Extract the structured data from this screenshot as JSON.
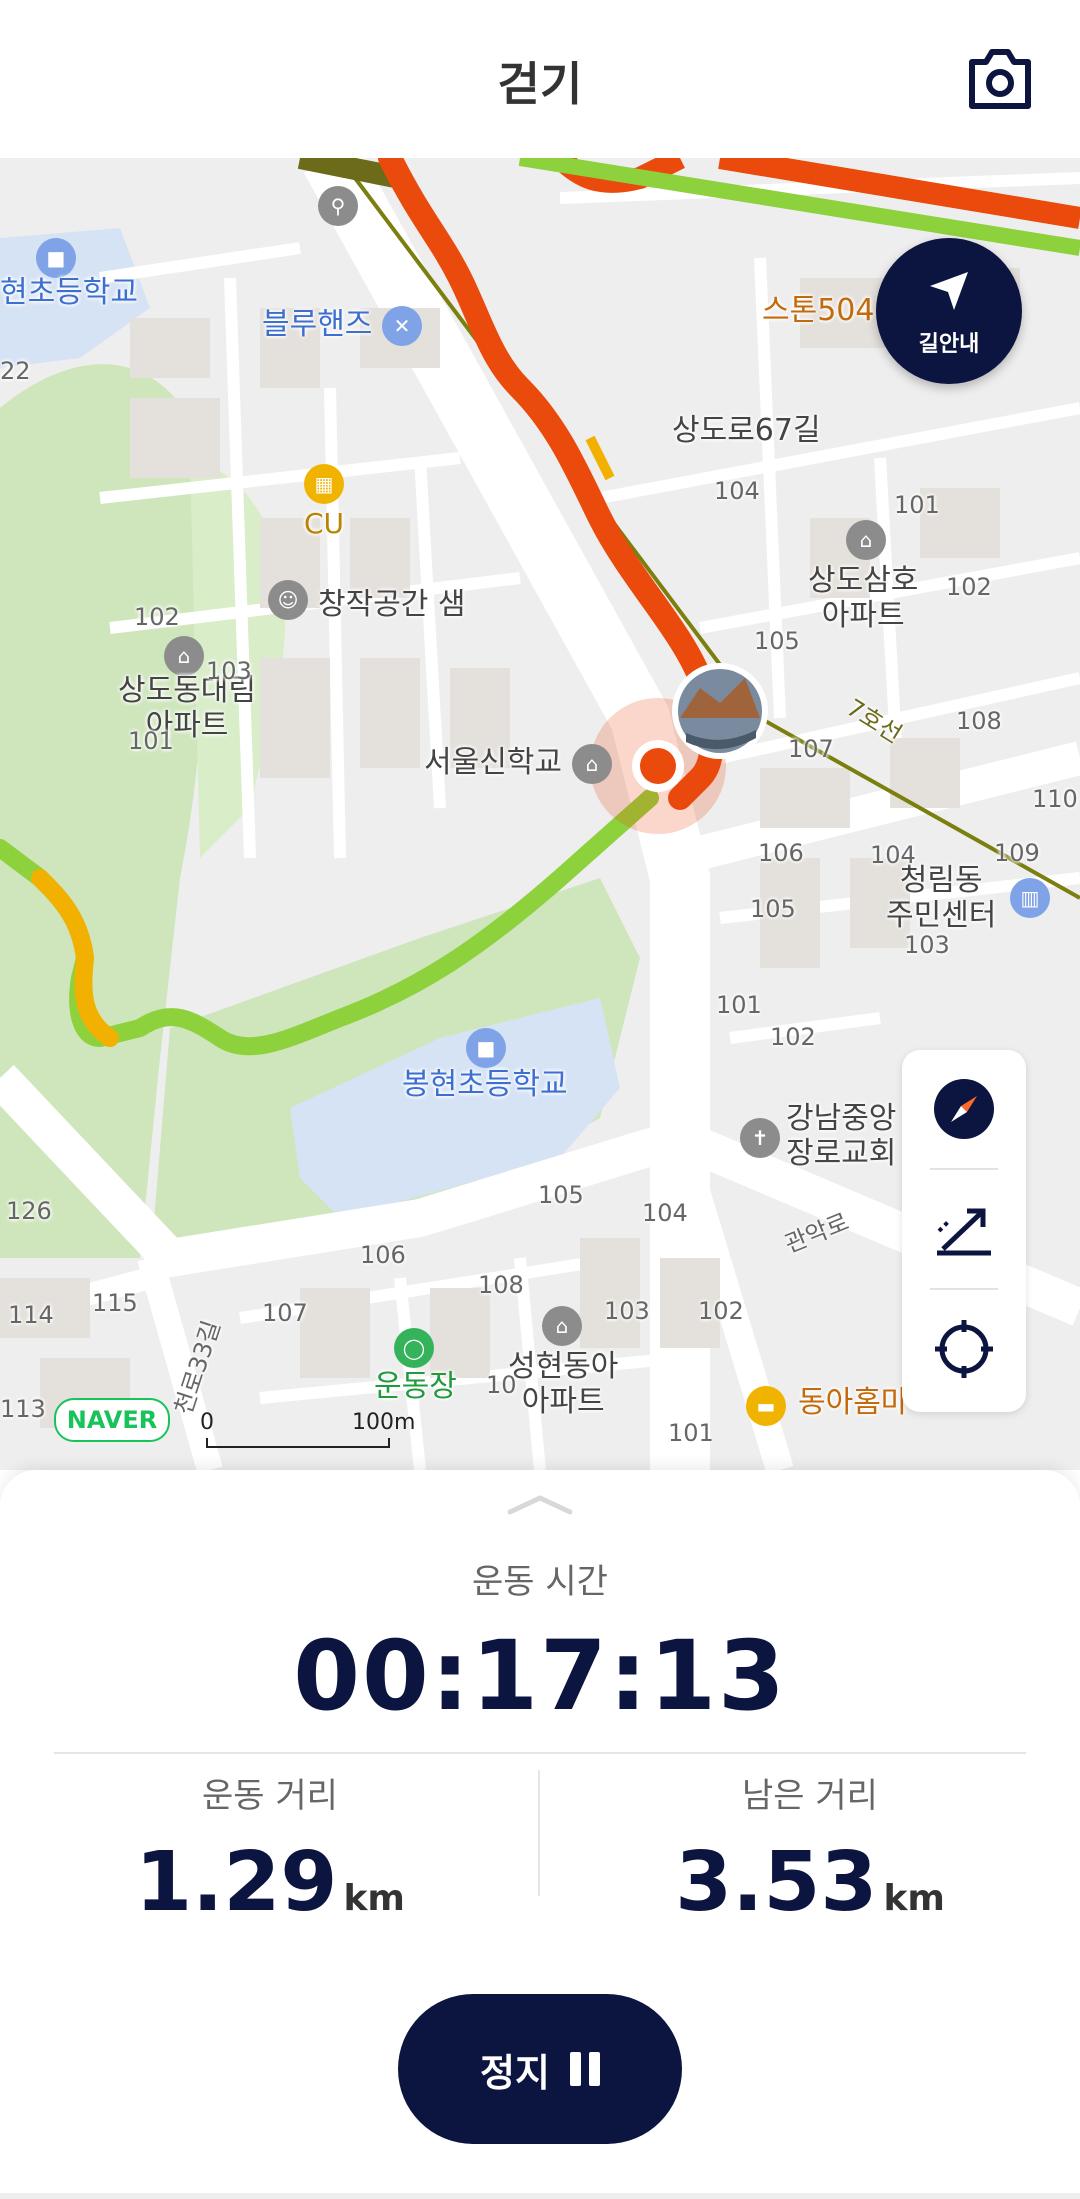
{
  "header": {
    "title": "걷기",
    "camera_icon": "camera-icon"
  },
  "map": {
    "nav_button_label": "길안내",
    "naver_logo": "NAVER",
    "scale": {
      "start": "0",
      "end": "100m"
    },
    "labels": {
      "school_topleft": "현초등학교",
      "blue_hands": "블루핸즈",
      "cu": "CU",
      "stone504": "스톤504",
      "sangdoro67": "상도로67길",
      "changjak": "창작공간 샘",
      "sangdo_daerim": "상도동대림\n아파트",
      "sangdo_samho": "상도삼호\n아파트",
      "seoul_school": "서울신학교",
      "line7": "7호선",
      "cheongnim_center": "청림동\n주민센터",
      "bonghyeon_school": "봉현초등학교",
      "gangnam_church": "강남중앙\n장로교회",
      "gwanak_ro": "관악로",
      "seonghyeon_apt": "성현동아\n아파트",
      "undongjang": "운동장",
      "donga_homemart": "동아홈마",
      "cheonro33": "천로33길",
      "n102a": "102",
      "n103a": "103",
      "n101a": "101",
      "n104a": "104",
      "n101b": "101",
      "n102b": "102",
      "n105a": "105",
      "n108a": "108",
      "n107a": "107",
      "n110": "110",
      "n106a": "106",
      "n104b": "104",
      "n109": "109",
      "n105b": "105",
      "n103b": "103",
      "n101c": "101",
      "n102c": "102",
      "n105c": "105",
      "n104c": "104",
      "n106b": "106",
      "n108b": "108",
      "n107b": "107",
      "n103c": "103",
      "n102d": "102",
      "n101d": "101",
      "n10x": "10",
      "n126": "126",
      "n114": "114",
      "n115": "115",
      "n113": "113",
      "n22": "22"
    }
  },
  "stats": {
    "time_label": "운동 시간",
    "time_value": "00:17:13",
    "distance_label": "운동 거리",
    "distance_value": "1.29",
    "distance_unit": "km",
    "remaining_label": "남은 거리",
    "remaining_value": "3.53",
    "remaining_unit": "km"
  },
  "stop_button": {
    "label": "정지"
  },
  "colors": {
    "navy": "#0c1440",
    "route_red": "#ea4a0c",
    "route_green": "#8dd13c",
    "route_yellow": "#f2b100",
    "park_green": "#cfe6bd"
  }
}
